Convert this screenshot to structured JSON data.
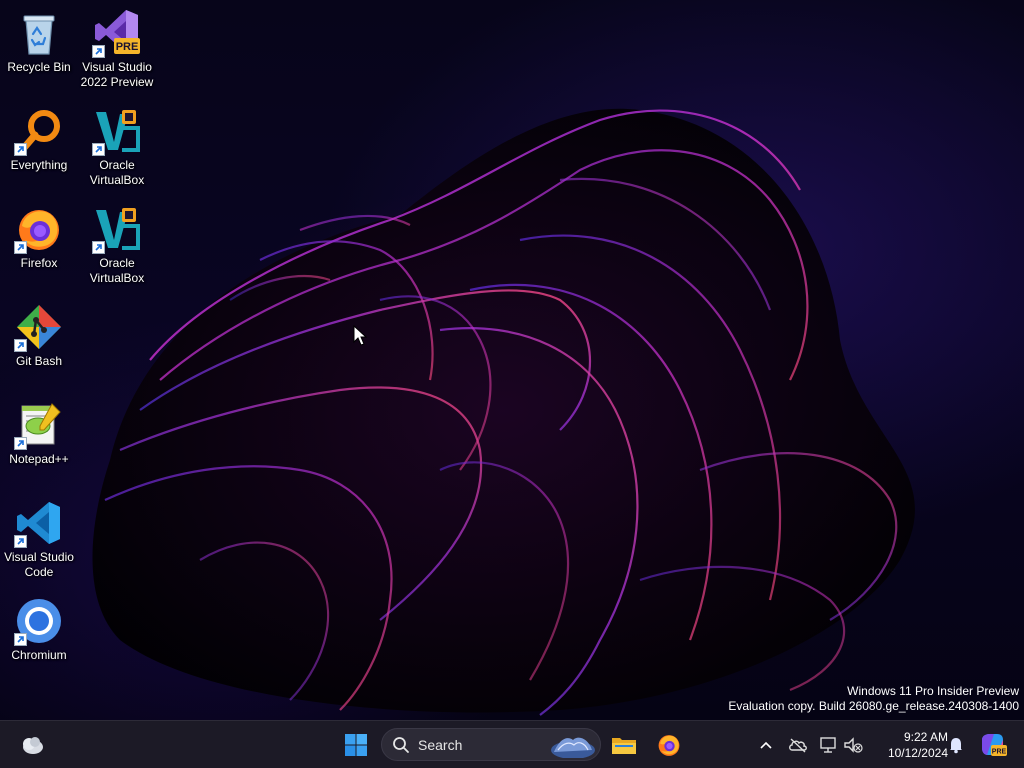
{
  "desktop": {
    "icons": [
      {
        "label": "Recycle Bin",
        "icon": "recycle-bin-icon"
      },
      {
        "label": "Visual Studio\n2022 Preview",
        "icon": "visual-studio-preview-icon",
        "badge": "PRE"
      },
      {
        "label": "Everything",
        "icon": "everything-search-icon"
      },
      {
        "label": "Oracle\nVirtualBox",
        "icon": "virtualbox-icon"
      },
      {
        "label": "Firefox",
        "icon": "firefox-icon"
      },
      {
        "label": "Oracle\nVirtualBox",
        "icon": "virtualbox-icon"
      },
      {
        "label": "Git Bash",
        "icon": "git-bash-icon"
      },
      {
        "label": "Notepad++",
        "icon": "notepad-plus-plus-icon"
      },
      {
        "label": "Visual Studio\nCode",
        "icon": "vscode-icon"
      },
      {
        "label": "Chromium",
        "icon": "chromium-icon"
      }
    ]
  },
  "watermark": {
    "line1": "Windows 11 Pro Insider Preview",
    "line2": "Evaluation copy. Build 26080.ge_release.240308-1400"
  },
  "taskbar": {
    "search_placeholder": "Search",
    "pinned": [
      "widgets-weather-icon",
      "start-icon",
      "file-explorer-icon",
      "firefox-icon"
    ],
    "tray": [
      "chevron-up-icon",
      "onedrive-offline-icon",
      "network-icon",
      "volume-muted-icon"
    ],
    "time": "9:22 AM",
    "date": "10/12/2024",
    "copilot_badge": "PRE"
  },
  "colors": {
    "taskbar_bg": "#1c1a26",
    "accent_blue": "#3aa0f0",
    "wallpaper_ribbon": "#c030c0"
  }
}
